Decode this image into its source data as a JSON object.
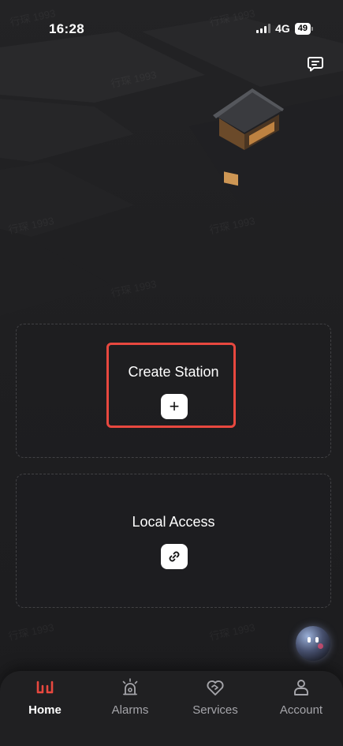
{
  "status_bar": {
    "time": "16:28",
    "network": "4G",
    "battery": "49"
  },
  "header": {
    "message_icon": "message-square-icon"
  },
  "cards": {
    "create_station": {
      "title": "Create Station",
      "action_symbol": "+",
      "icon": "plus-icon"
    },
    "local_access": {
      "title": "Local Access",
      "icon": "link-icon"
    }
  },
  "highlight_color": "#e8483f",
  "tabs": [
    {
      "label": "Home",
      "icon": "home-logo-icon",
      "active": true
    },
    {
      "label": "Alarms",
      "icon": "alarm-siren-icon",
      "active": false
    },
    {
      "label": "Services",
      "icon": "heart-handshake-icon",
      "active": false
    },
    {
      "label": "Account",
      "icon": "user-icon",
      "active": false
    }
  ],
  "colors": {
    "accent": "#e8483f",
    "background": "#1e1e20",
    "tab_inactive": "#a5a5aa"
  }
}
